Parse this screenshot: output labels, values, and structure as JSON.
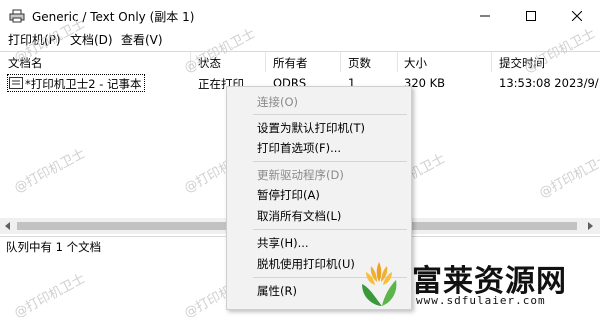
{
  "window": {
    "title": "Generic / Text Only (副本 1)",
    "controls": {
      "minimize": "—",
      "maximize": "☐",
      "close": "✕"
    }
  },
  "menubar": {
    "items": [
      "打印机(P)",
      "文档(D)",
      "查看(V)"
    ]
  },
  "columns": [
    "文档名",
    "状态",
    "所有者",
    "页数",
    "大小",
    "提交时间"
  ],
  "jobs": [
    {
      "doc_name": "*打印机卫士2 - 记事本",
      "status": "正在打印",
      "owner": "ODRS",
      "pages": "1",
      "size": "320 KB",
      "submitted": "13:53:08   2023/9/"
    }
  ],
  "statusbar": {
    "text": "队列中有 1 个文档"
  },
  "context_menu": {
    "items": [
      {
        "label": "连接(O)",
        "disabled": true
      },
      {
        "label": "设置为默认打印机(T)",
        "disabled": false
      },
      {
        "label": "打印首选项(F)...",
        "disabled": false
      },
      {
        "label": "更新驱动程序(D)",
        "disabled": true
      },
      {
        "label": "暂停打印(A)",
        "disabled": false
      },
      {
        "label": "取消所有文档(L)",
        "disabled": false
      },
      {
        "label": "共享(H)...",
        "disabled": false
      },
      {
        "label": "脱机使用打印机(U)",
        "disabled": false
      },
      {
        "label": "属性(R)",
        "disabled": false
      }
    ]
  },
  "watermark": "@打印机卫士",
  "brand": {
    "name": "富莱资源网",
    "url": "www.sdfulaier.com"
  },
  "colors": {
    "accent": "#f0a020",
    "brand_green": "#3a9a3a",
    "disabled_text": "#8a8a8a"
  }
}
